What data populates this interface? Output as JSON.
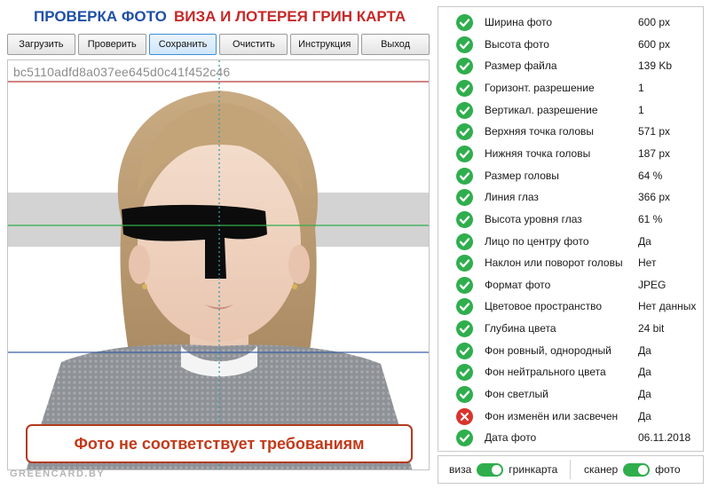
{
  "header": {
    "title_left": "ПРОВЕРКА ФОТО",
    "title_right": "ВИЗА И ЛОТЕРЕЯ ГРИН КАРТА"
  },
  "toolbar": {
    "load": "Загрузить",
    "check": "Проверить",
    "save": "Сохранить",
    "clear": "Очистить",
    "instructions": "Инструкция",
    "exit": "Выход"
  },
  "photo": {
    "id_text": "bc5110adfd8a037ee645d0c41f452c46",
    "status_text": "Фото не соответствует требованиям",
    "watermark": "GREENCARD.BY"
  },
  "checks": [
    {
      "label": "Ширина фото",
      "value": "600 px",
      "status": "ok"
    },
    {
      "label": "Высота фото",
      "value": "600 px",
      "status": "ok"
    },
    {
      "label": "Размер файла",
      "value": "139 Kb",
      "status": "ok"
    },
    {
      "label": "Горизонт. разрешение",
      "value": "1",
      "status": "ok"
    },
    {
      "label": "Вертикал. разрешение",
      "value": "1",
      "status": "ok"
    },
    {
      "label": "Верхняя точка головы",
      "value": "571 px",
      "status": "ok"
    },
    {
      "label": "Нижняя точка головы",
      "value": "187 px",
      "status": "ok"
    },
    {
      "label": "Размер головы",
      "value": "64 %",
      "status": "ok"
    },
    {
      "label": "Линия глаз",
      "value": "366 px",
      "status": "ok"
    },
    {
      "label": "Высота уровня глаз",
      "value": "61 %",
      "status": "ok"
    },
    {
      "label": "Лицо по центру фото",
      "value": "Да",
      "status": "ok"
    },
    {
      "label": "Наклон или поворот головы",
      "value": "Нет",
      "status": "ok"
    },
    {
      "label": "Формат фото",
      "value": "JPEG",
      "status": "ok"
    },
    {
      "label": "Цветовое пространство",
      "value": "Нет данных",
      "status": "ok"
    },
    {
      "label": "Глубина цвета",
      "value": "24 bit",
      "status": "ok"
    },
    {
      "label": "Фон ровный, однородный",
      "value": "Да",
      "status": "ok"
    },
    {
      "label": "Фон нейтрального цвета",
      "value": "Да",
      "status": "ok"
    },
    {
      "label": "Фон светлый",
      "value": "Да",
      "status": "ok"
    },
    {
      "label": "Фон изменён или засвечен",
      "value": "Да",
      "status": "fail"
    },
    {
      "label": "Дата фото",
      "value": "06.11.2018",
      "status": "ok"
    }
  ],
  "modes": {
    "left_a": "виза",
    "left_b": "гринкарта",
    "right_a": "сканер",
    "right_b": "фото"
  },
  "colors": {
    "ok": "#2fae4d",
    "fail": "#d9342b",
    "title_blue": "#1f4fa6",
    "title_red": "#c62828"
  }
}
